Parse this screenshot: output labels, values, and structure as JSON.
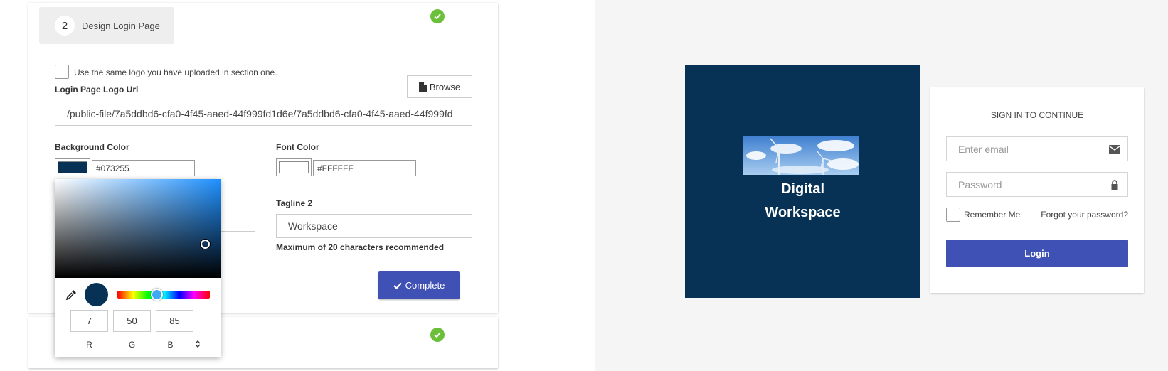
{
  "theme": {
    "accent": "#3f51b5",
    "success": "#6cbf3a",
    "background_color": "#073255",
    "font_color": "#FFFFFF"
  },
  "step": {
    "number": "2",
    "title": "Design Login Page"
  },
  "logo": {
    "same_logo_label": "Use the same logo you have uploaded in section one.",
    "url_label": "Login Page Logo Url",
    "browse_label": "Browse",
    "url_value": "/public-file/7a5ddbd6-cfa0-4f45-aaed-44f999fd1d6e/7a5ddbd6-cfa0-4f45-aaed-44f999fd"
  },
  "colors": {
    "bg_label": "Background Color",
    "bg_value": "#073255",
    "font_label": "Font Color",
    "font_value": "#FFFFFF"
  },
  "tagline2": {
    "label": "Tagline 2",
    "value": "Workspace",
    "hint": "Maximum of 20 characters recommended"
  },
  "complete_label": "Complete",
  "picker": {
    "r": "7",
    "g": "50",
    "b": "85",
    "r_label": "R",
    "g_label": "G",
    "b_label": "B"
  },
  "preview": {
    "tagline1": "Digital",
    "tagline2": "Workspace",
    "signin_title": "SIGN IN TO CONTINUE",
    "email_placeholder": "Enter email",
    "password_placeholder": "Password",
    "remember_label": "Remember Me",
    "forgot_label": "Forgot your password?",
    "login_label": "Login"
  }
}
